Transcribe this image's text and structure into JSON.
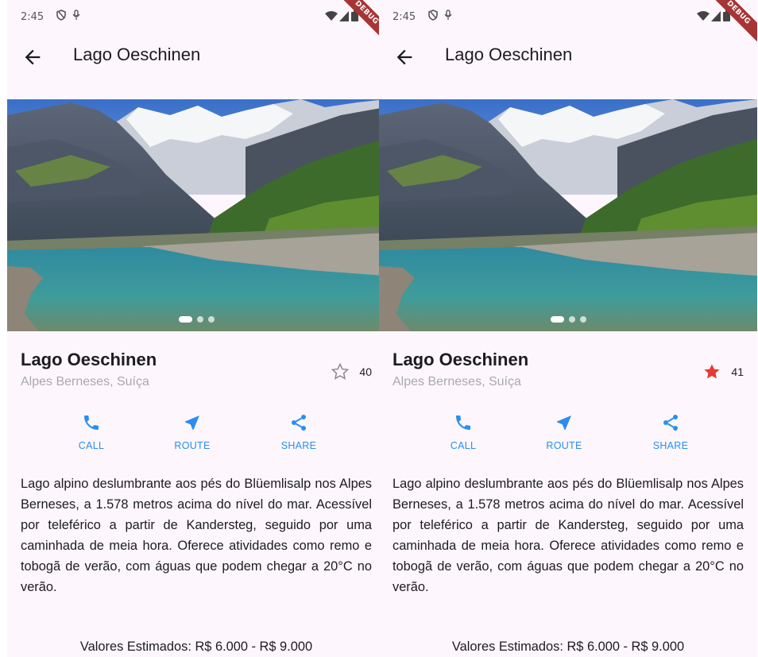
{
  "theme": {
    "accent": "#2a8ef0",
    "star_filled": "#e53935",
    "background": "#fdf7fd"
  },
  "screens": [
    {
      "status": {
        "time": "2:45",
        "debug": "DEBUG"
      },
      "appbar": {
        "title": "Lago Oeschinen",
        "back_icon": "arrow-left-icon"
      },
      "carousel": {
        "page_count": 3,
        "active_index": 0
      },
      "place": {
        "name": "Lago Oeschinen",
        "location": "Alpes Berneses, Suíça"
      },
      "favorite": {
        "icon": "star-outline-icon",
        "filled": false,
        "count": "40"
      },
      "actions": [
        {
          "icon": "phone-icon",
          "label": "CALL"
        },
        {
          "icon": "navigation-icon",
          "label": "ROUTE"
        },
        {
          "icon": "share-icon",
          "label": "SHARE"
        }
      ],
      "description": "Lago alpino deslumbrante aos pés do Blüemlisalp nos Alpes Berneses, a 1.578 metros acima do nível do mar. Acessível por teleférico a partir de Kandersteg, seguido por uma caminhada de meia hora. Oferece atividades como remo e tobogã de verão, com águas que podem chegar a 20°C no verão.",
      "price": "Valores Estimados: R$ 6.000 - R$ 9.000"
    },
    {
      "status": {
        "time": "2:45",
        "debug": "DEBUG"
      },
      "appbar": {
        "title": "Lago Oeschinen",
        "back_icon": "arrow-left-icon"
      },
      "carousel": {
        "page_count": 3,
        "active_index": 0
      },
      "place": {
        "name": "Lago Oeschinen",
        "location": "Alpes Berneses, Suíça"
      },
      "favorite": {
        "icon": "star-filled-icon",
        "filled": true,
        "count": "41"
      },
      "actions": [
        {
          "icon": "phone-icon",
          "label": "CALL"
        },
        {
          "icon": "navigation-icon",
          "label": "ROUTE"
        },
        {
          "icon": "share-icon",
          "label": "SHARE"
        }
      ],
      "description": "Lago alpino deslumbrante aos pés do Blüemlisalp nos Alpes Berneses, a 1.578 metros acima do nível do mar. Acessível por teleférico a partir de Kandersteg, seguido por uma caminhada de meia hora. Oferece atividades como remo e tobogã de verão, com águas que podem chegar a 20°C no verão.",
      "price": "Valores Estimados: R$ 6.000 - R$ 9.000"
    }
  ]
}
